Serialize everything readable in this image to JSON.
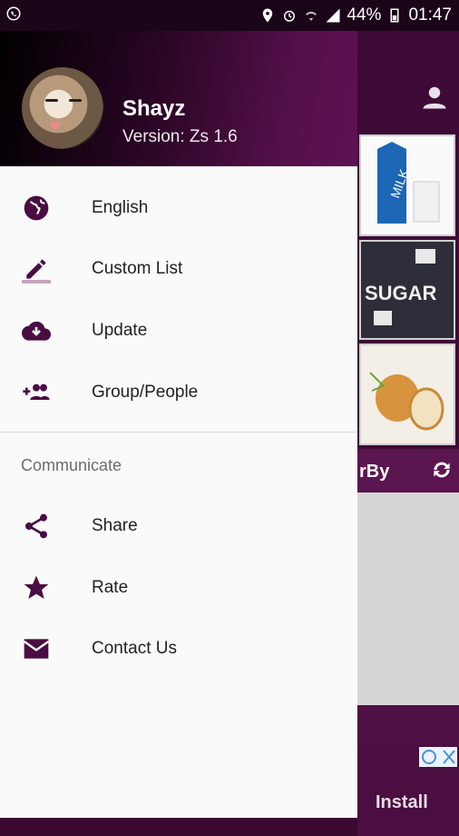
{
  "status_bar": {
    "battery": "44%",
    "time": "01:47"
  },
  "drawer": {
    "header": {
      "name": "Shayz",
      "version": "Version: Zs 1.6"
    },
    "items": [
      {
        "label": "English",
        "icon": "globe-icon"
      },
      {
        "label": "Custom List",
        "icon": "edit-icon"
      },
      {
        "label": "Update",
        "icon": "cloud-download-icon"
      },
      {
        "label": "Group/People",
        "icon": "group-add-icon"
      }
    ],
    "section_title": "Communicate",
    "communicate_items": [
      {
        "label": "Share",
        "icon": "share-icon"
      },
      {
        "label": "Rate",
        "icon": "star-icon"
      },
      {
        "label": "Contact Us",
        "icon": "mail-icon"
      }
    ]
  },
  "background": {
    "sort_label": "rBy",
    "thumb_labels": [
      "MILK",
      "SUGAR"
    ],
    "ad_install": "Install"
  },
  "colors": {
    "accent": "#4a0c42",
    "header_dark": "#1b0518"
  }
}
